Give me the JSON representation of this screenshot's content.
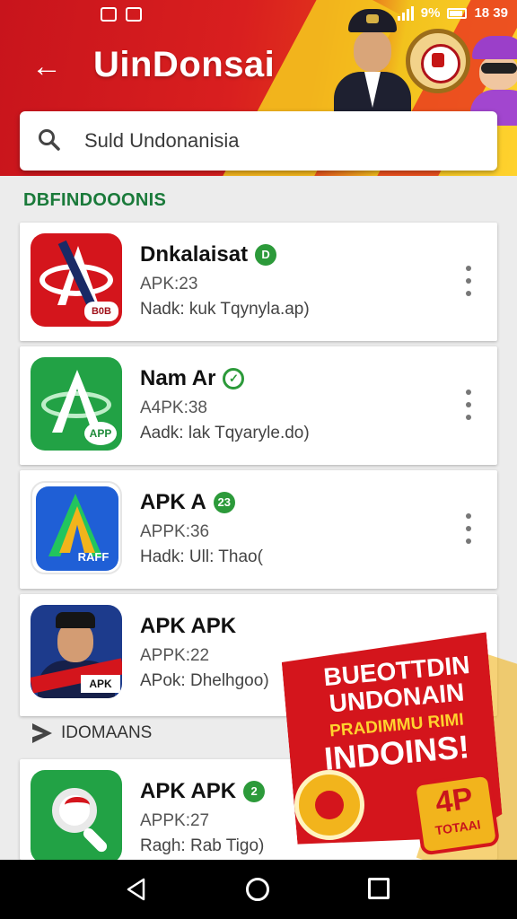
{
  "status_bar": {
    "battery_percent": "9%",
    "time": "18 39"
  },
  "header": {
    "title": "UinDonsai"
  },
  "search": {
    "placeholder": "Suld Undonanisia"
  },
  "section": {
    "title": "DBFINDOOONIS"
  },
  "apps": [
    {
      "name": "Dnkalaisat",
      "badge": "D",
      "line1": "APK:23",
      "line2": "Nadk: kuk Tqynyla.ap)",
      "icon": "red-a-orbit-icon",
      "icon_tag": "B0B"
    },
    {
      "name": "Nam Ar",
      "badge": "✓",
      "line1": "A4PK:38",
      "line2": "Aadk: lak Tqyaryle.do)",
      "icon": "green-a-orbit-icon",
      "icon_tag": "APP"
    },
    {
      "name": "APK A",
      "badge": "23",
      "line1": "APPK:36",
      "line2": "Hadk: Ull: Thao(",
      "icon": "blue-a-logo-icon",
      "icon_tag": "RAFF"
    },
    {
      "name": "APK APK",
      "badge": "",
      "line1": "APPK:22",
      "line2": "APok: Dhelhgoo)",
      "icon": "officer-portrait-icon",
      "icon_tag": "APK"
    },
    {
      "name": "APK APK",
      "badge": "2",
      "line1": "APPK:27",
      "line2": "Ragh: Rab Tigo)",
      "icon": "magnifier-icon",
      "icon_tag": ""
    }
  ],
  "subsection": {
    "label": "IDOMAANS"
  },
  "promo": {
    "line1": "BUEOTTDIN",
    "line2": "UNDONAIN",
    "line3": "PRADIMMU RIMI",
    "line4": "INDOINS!",
    "price_big": "4P",
    "price_small": "TOTAAI"
  },
  "colors": {
    "header_red": "#d91f1f",
    "accent_yellow": "#f2c21d",
    "badge_green": "#2c9a3a",
    "section_green": "#1a7a3a"
  }
}
